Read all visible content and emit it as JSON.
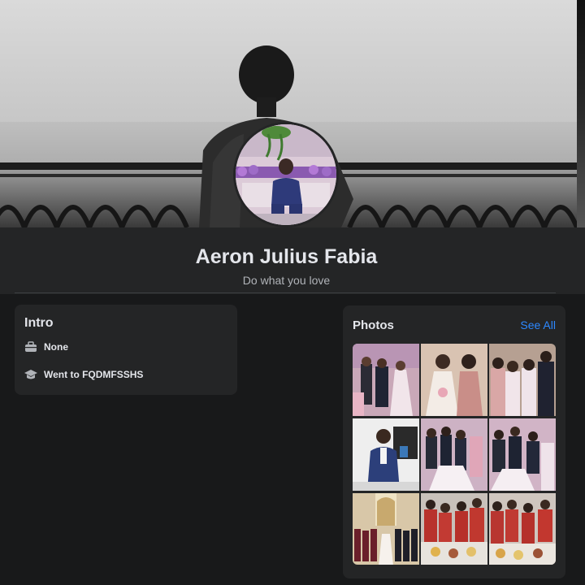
{
  "profile": {
    "name": "Aeron Julius Fabia",
    "bio": "Do what you love"
  },
  "intro": {
    "title": "Intro",
    "items": [
      {
        "icon": "briefcase-icon",
        "text": "None"
      },
      {
        "icon": "graduation-cap-icon",
        "text": "Went to FQDMFSSHS"
      }
    ]
  },
  "photos": {
    "title": "Photos",
    "see_all": "See All",
    "count": 9
  },
  "colors": {
    "background": "#18191a",
    "card": "#242526",
    "text_primary": "#e4e6eb",
    "text_secondary": "#b0b3b8",
    "link": "#2d88ff"
  }
}
